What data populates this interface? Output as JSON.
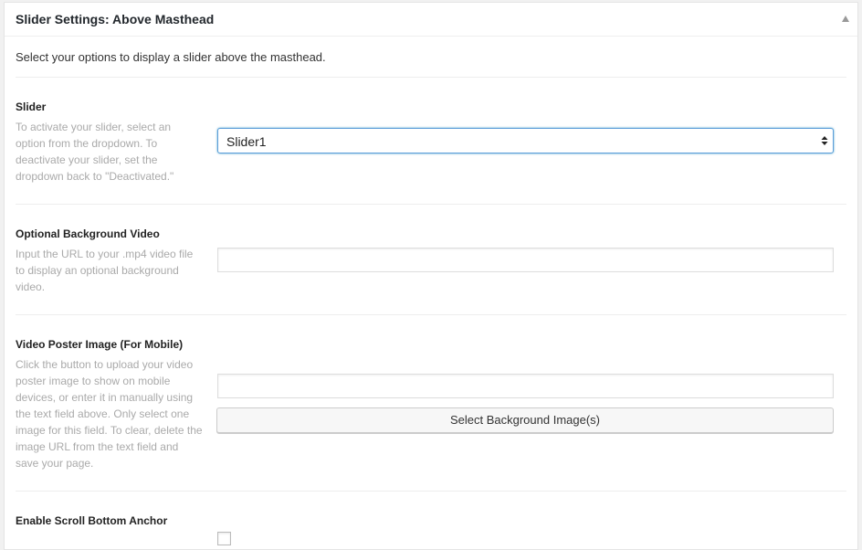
{
  "metabox": {
    "title": "Slider Settings: Above Masthead",
    "intro": "Select your options to display a slider above the masthead."
  },
  "fields": {
    "slider": {
      "label": "Slider",
      "description": "To activate your slider, select an option from the dropdown. To deactivate your slider, set the dropdown back to \"Deactivated.\"",
      "selected": "Slider1"
    },
    "background_video": {
      "label": "Optional Background Video",
      "description": "Input the URL to your .mp4 video file to display an optional background video.",
      "value": ""
    },
    "poster_image": {
      "label": "Video Poster Image (For Mobile)",
      "description": "Click the button to upload your video poster image to show on mobile devices, or enter it in manually using the text field above. Only select one image for this field. To clear, delete the image URL from the text field and save your page.",
      "value": "",
      "button_label": "Select Background Image(s)"
    },
    "scroll_anchor": {
      "label": "Enable Scroll Bottom Anchor"
    }
  },
  "icons": {
    "toggle": "triangle-up-icon",
    "select": "select-arrows-icon"
  },
  "colors": {
    "focus_border": "#5b9dd9",
    "muted_text": "#aaaaaa",
    "divider": "#eeeeee"
  }
}
